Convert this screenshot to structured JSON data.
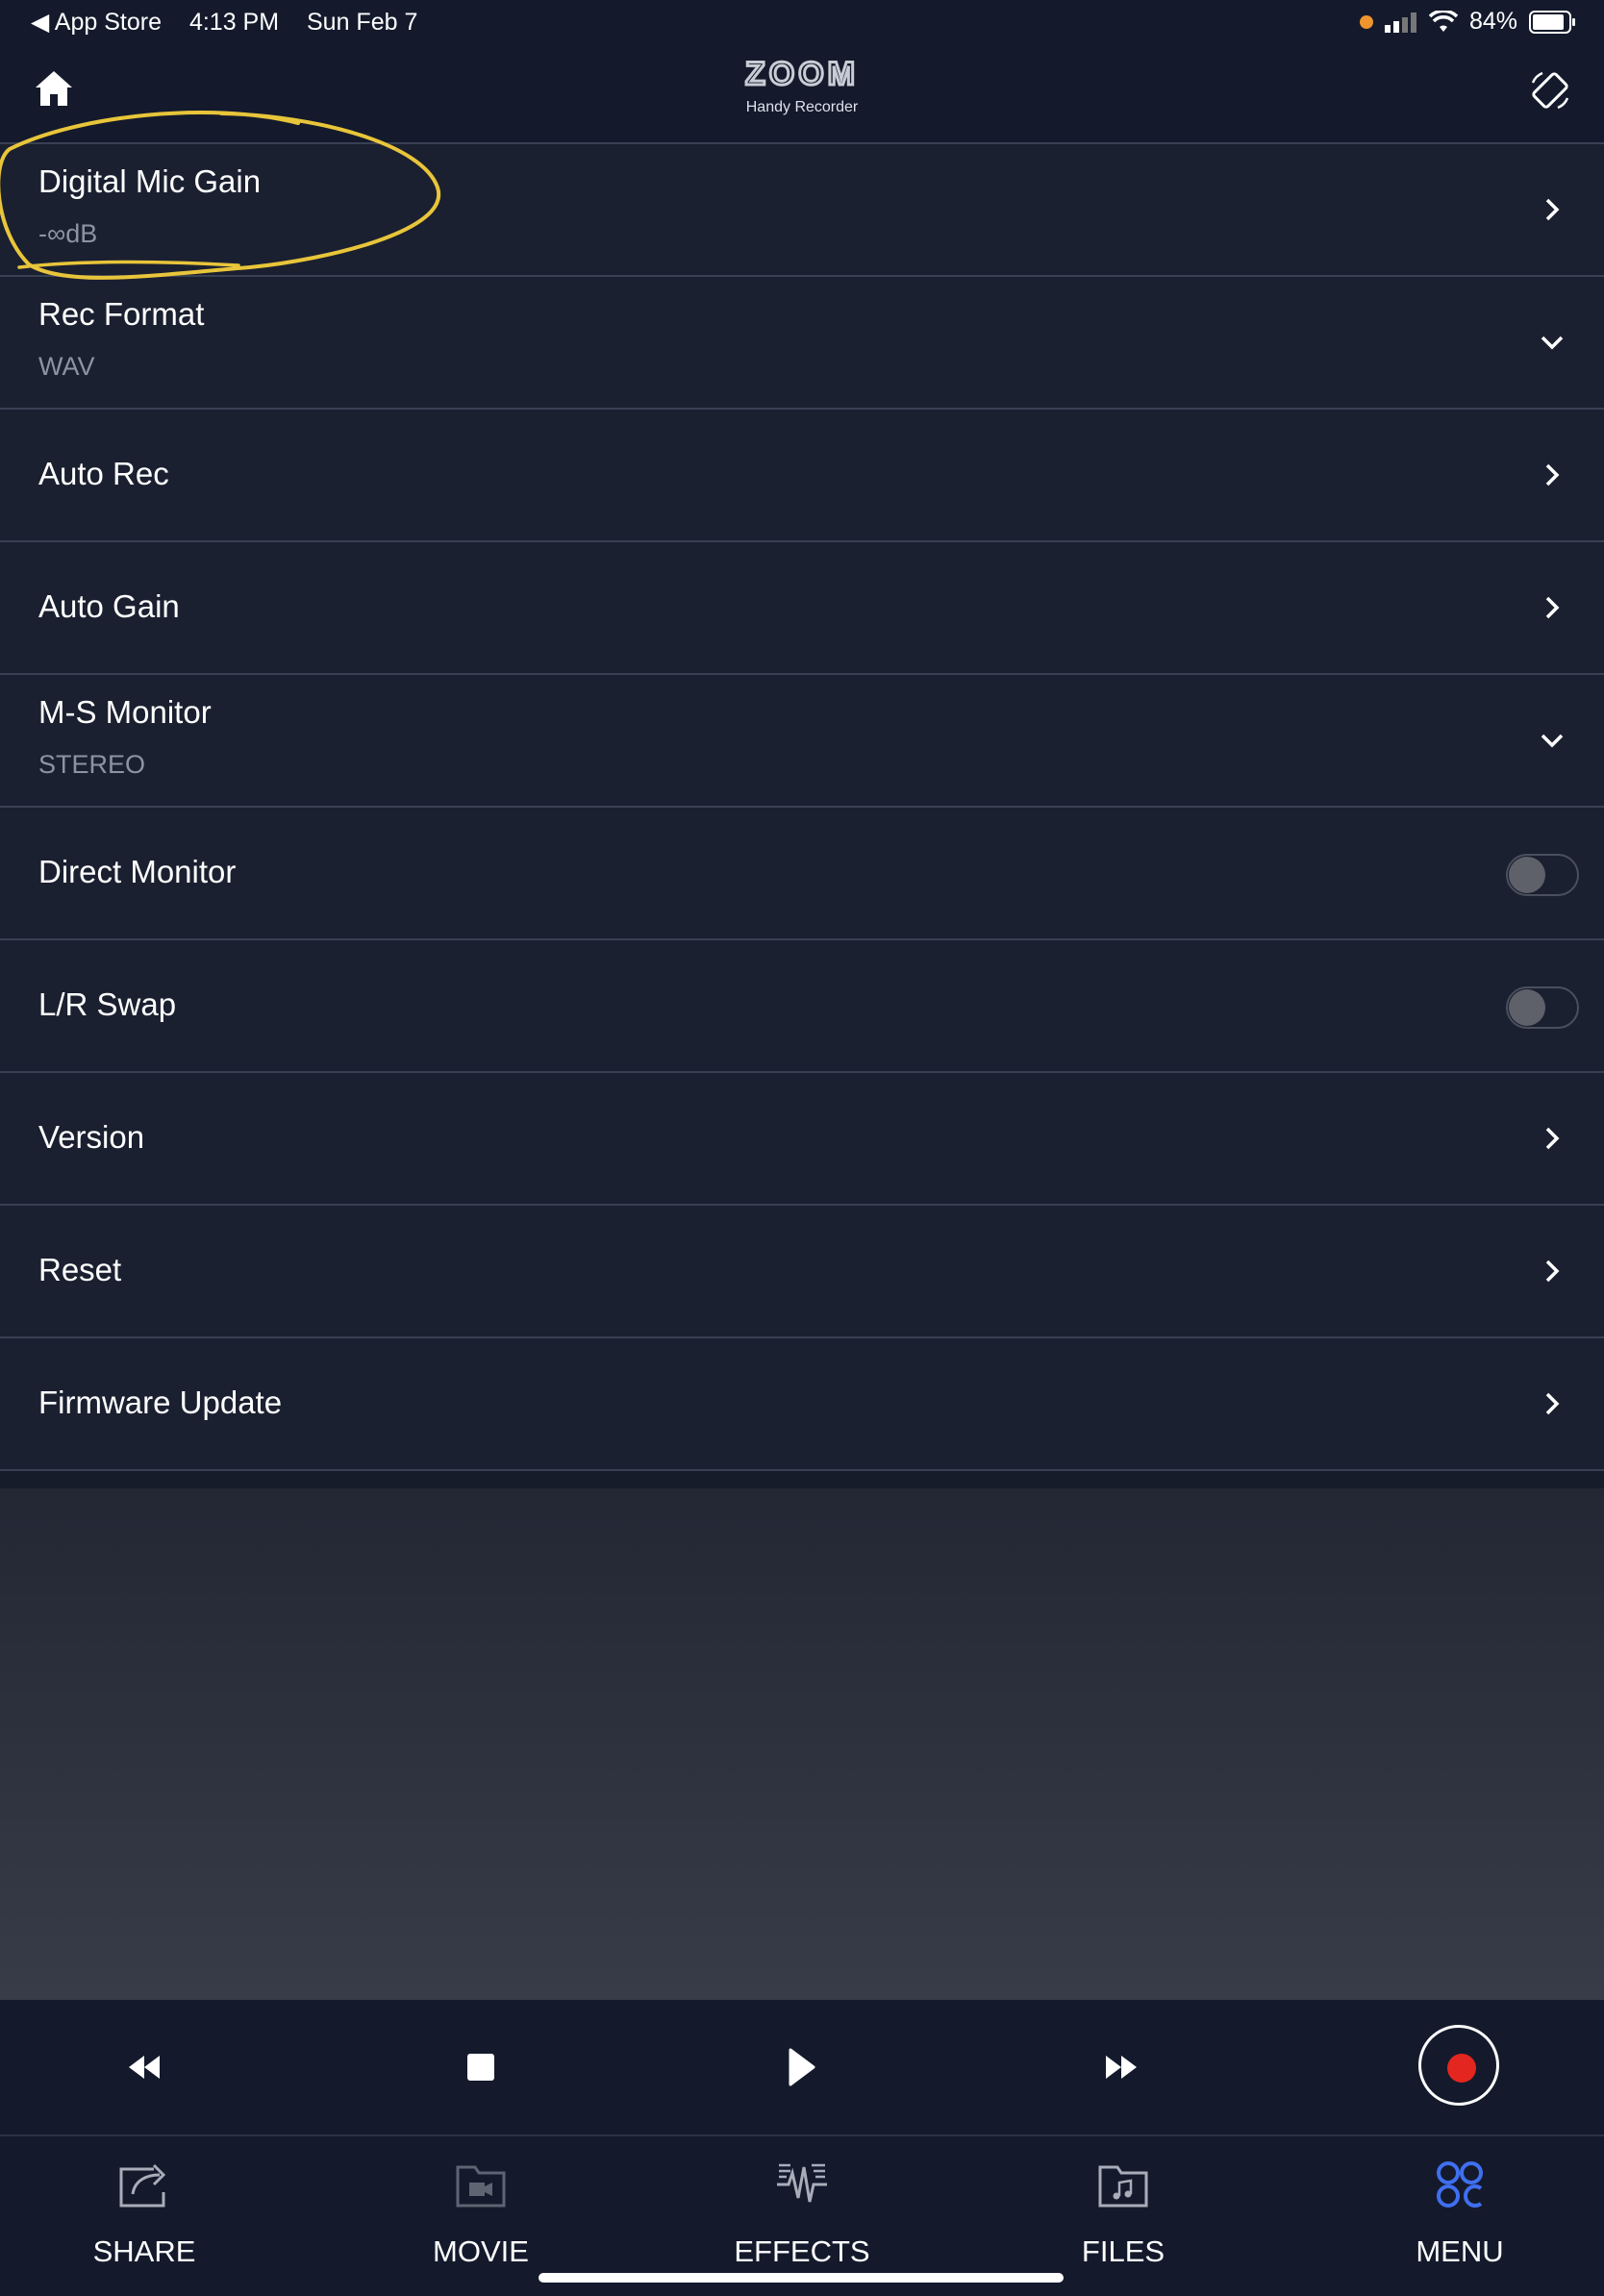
{
  "status_bar": {
    "back_app": "App Store",
    "time": "4:13 PM",
    "date": "Sun Feb 7",
    "battery": "84%"
  },
  "header": {
    "logo_text": "ZOOM",
    "logo_subtitle": "Handy Recorder"
  },
  "settings": [
    {
      "title": "Digital Mic Gain",
      "value": "-∞dB",
      "control": "chevron-right"
    },
    {
      "title": "Rec Format",
      "value": "WAV",
      "control": "chevron-down"
    },
    {
      "title": "Auto Rec",
      "control": "chevron-right"
    },
    {
      "title": "Auto Gain",
      "control": "chevron-right"
    },
    {
      "title": "M-S Monitor",
      "value": "STEREO",
      "control": "chevron-down"
    },
    {
      "title": "Direct Monitor",
      "control": "toggle",
      "on": false
    },
    {
      "title": "L/R Swap",
      "control": "toggle",
      "on": false
    },
    {
      "title": "Version",
      "control": "chevron-right"
    },
    {
      "title": "Reset",
      "control": "chevron-right"
    },
    {
      "title": "Firmware Update",
      "control": "chevron-right"
    }
  ],
  "transport": {
    "buttons": [
      "rewind-icon",
      "stop-icon",
      "play-icon",
      "fast-forward-icon",
      "record-icon"
    ],
    "record_color": "#e3261f"
  },
  "tabs": [
    {
      "label": "SHARE",
      "icon": "share-icon"
    },
    {
      "label": "MOVIE",
      "icon": "movie-icon"
    },
    {
      "label": "EFFECTS",
      "icon": "effects-icon"
    },
    {
      "label": "FILES",
      "icon": "files-icon"
    },
    {
      "label": "MENU",
      "icon": "menu-grid-icon",
      "active": true
    }
  ],
  "colors": {
    "background": "#171c2b",
    "accent_active": "#3f6ff0",
    "annotation": "#e8c53a"
  }
}
